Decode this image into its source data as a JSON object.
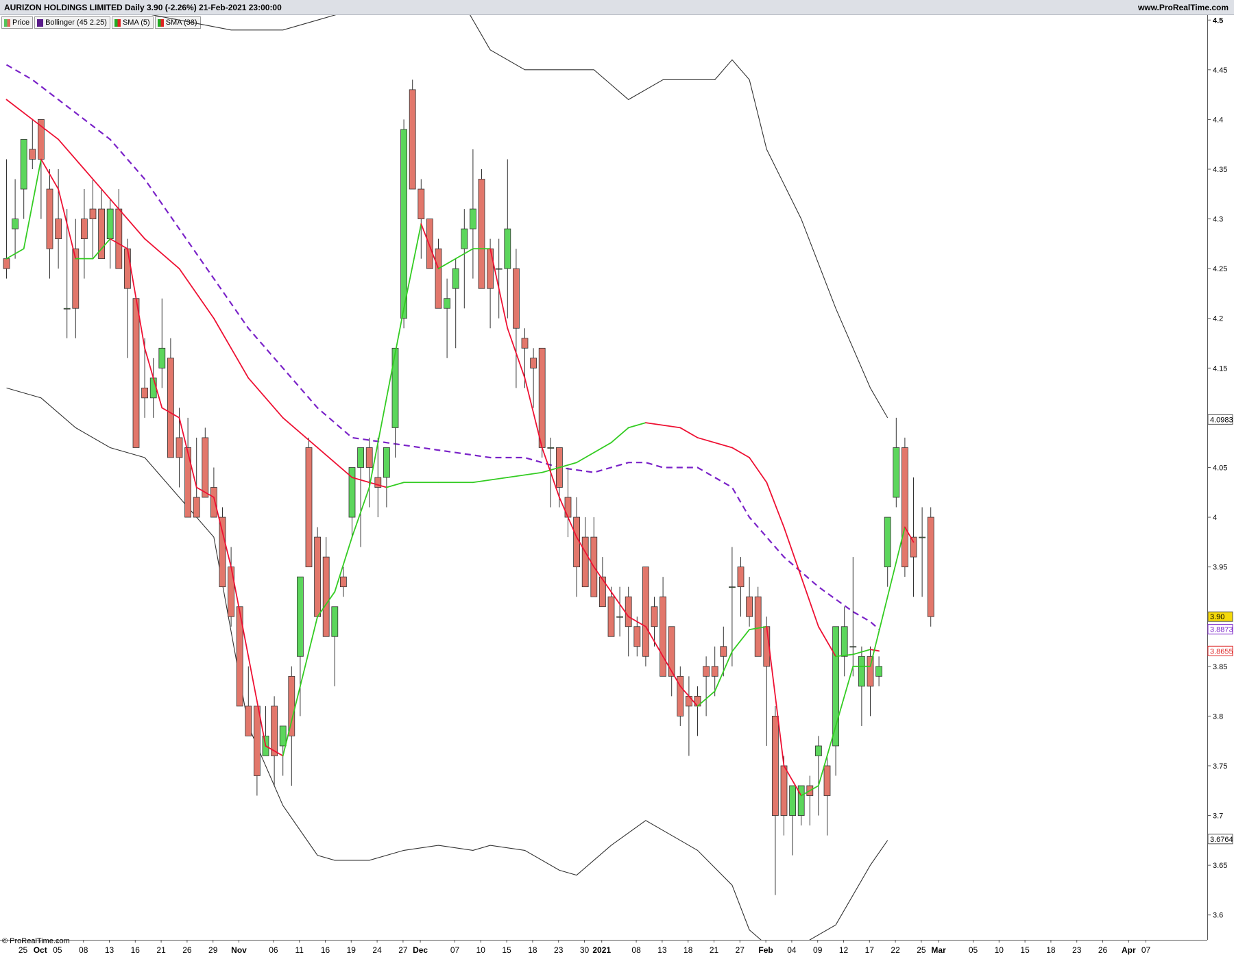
{
  "header": {
    "title": "AURIZON HOLDINGS LIMITED Daily 3.90 (-2.26%) 21-Feb-2021 23:00:00",
    "site": "www.ProRealTime.com"
  },
  "legend": [
    {
      "label": "Price",
      "colors": [
        "#55c45a",
        "#e06a5c"
      ]
    },
    {
      "label": "Bollinger (45 2.25)",
      "colors": [
        "#5a1c8a",
        "#5a1c8a"
      ]
    },
    {
      "label": "SMA (5)",
      "colors": [
        "#22aa22",
        "#dd2222"
      ]
    },
    {
      "label": "SMA (38)",
      "colors": [
        "#22aa22",
        "#dd2222"
      ]
    }
  ],
  "copyright": "© ProRealTime.com",
  "colors": {
    "up": "#5cd65c",
    "down": "#e2776b",
    "band": "#333333",
    "mid": "#7a22c8",
    "sma_up": "#33cc22",
    "sma_down": "#ee1133"
  },
  "chart_data": {
    "type": "candlestick",
    "ylim": [
      3.575,
      4.505
    ],
    "y_ticks": [
      "4.5",
      "4.45",
      "4.4",
      "4.35",
      "4.3",
      "4.25",
      "4.2",
      "4.15",
      "4.1",
      "4.05",
      "4",
      "3.95",
      "3.9",
      "3.85",
      "3.8",
      "3.75",
      "3.7",
      "3.65",
      "3.6"
    ],
    "x_ticks": [
      {
        "label": "25",
        "i": 0
      },
      {
        "label": "Oct",
        "i": 2,
        "bold": true
      },
      {
        "label": "05",
        "i": 4
      },
      {
        "label": "08",
        "i": 7
      },
      {
        "label": "13",
        "i": 10
      },
      {
        "label": "16",
        "i": 13
      },
      {
        "label": "21",
        "i": 16
      },
      {
        "label": "26",
        "i": 19
      },
      {
        "label": "29",
        "i": 22
      },
      {
        "label": "Nov",
        "i": 25,
        "bold": true
      },
      {
        "label": "06",
        "i": 29
      },
      {
        "label": "11",
        "i": 32
      },
      {
        "label": "16",
        "i": 35
      },
      {
        "label": "19",
        "i": 38
      },
      {
        "label": "24",
        "i": 41
      },
      {
        "label": "27",
        "i": 44
      },
      {
        "label": "Dec",
        "i": 46,
        "bold": true
      },
      {
        "label": "07",
        "i": 50
      },
      {
        "label": "10",
        "i": 53
      },
      {
        "label": "15",
        "i": 56
      },
      {
        "label": "18",
        "i": 59
      },
      {
        "label": "23",
        "i": 62
      },
      {
        "label": "30",
        "i": 65
      },
      {
        "label": "2021",
        "i": 67,
        "bold": true
      },
      {
        "label": "08",
        "i": 71
      },
      {
        "label": "13",
        "i": 74
      },
      {
        "label": "18",
        "i": 77
      },
      {
        "label": "21",
        "i": 80
      },
      {
        "label": "27",
        "i": 83
      },
      {
        "label": "Feb",
        "i": 86,
        "bold": true
      },
      {
        "label": "04",
        "i": 89
      },
      {
        "label": "09",
        "i": 92
      },
      {
        "label": "12",
        "i": 95
      },
      {
        "label": "17",
        "i": 98
      },
      {
        "label": "22",
        "i": 101
      },
      {
        "label": "25",
        "i": 104
      },
      {
        "label": "Mar",
        "i": 106,
        "bold": true
      },
      {
        "label": "05",
        "i": 110
      },
      {
        "label": "10",
        "i": 113
      },
      {
        "label": "15",
        "i": 116
      },
      {
        "label": "18",
        "i": 119
      },
      {
        "label": "23",
        "i": 122
      },
      {
        "label": "26",
        "i": 125
      },
      {
        "label": "Apr",
        "i": 128,
        "bold": true
      },
      {
        "label": "07",
        "i": 130
      }
    ],
    "candles": [
      [
        4.26,
        4.36,
        4.24,
        4.25
      ],
      [
        4.29,
        4.34,
        4.26,
        4.3
      ],
      [
        4.33,
        4.38,
        4.3,
        4.38
      ],
      [
        4.37,
        4.4,
        4.35,
        4.36
      ],
      [
        4.4,
        4.4,
        4.3,
        4.36
      ],
      [
        4.33,
        4.35,
        4.24,
        4.27
      ],
      [
        4.3,
        4.35,
        4.25,
        4.28
      ],
      [
        4.21,
        4.31,
        4.18,
        4.21
      ],
      [
        4.27,
        4.3,
        4.18,
        4.21
      ],
      [
        4.3,
        4.33,
        4.24,
        4.28
      ],
      [
        4.31,
        4.34,
        4.26,
        4.3
      ],
      [
        4.31,
        4.33,
        4.26,
        4.26
      ],
      [
        4.28,
        4.32,
        4.25,
        4.31
      ],
      [
        4.31,
        4.33,
        4.26,
        4.25
      ],
      [
        4.27,
        4.28,
        4.16,
        4.23
      ],
      [
        4.22,
        4.22,
        4.15,
        4.07
      ],
      [
        4.13,
        4.18,
        4.1,
        4.12
      ],
      [
        4.12,
        4.16,
        4.1,
        4.14
      ],
      [
        4.15,
        4.22,
        4.13,
        4.17
      ],
      [
        4.16,
        4.18,
        4.06,
        4.06
      ],
      [
        4.08,
        4.11,
        4.03,
        4.06
      ],
      [
        4.07,
        4.1,
        4.04,
        4.0
      ],
      [
        4.02,
        4.08,
        4.0,
        4.0
      ],
      [
        4.08,
        4.09,
        4.03,
        4.02
      ],
      [
        4.03,
        4.05,
        4.0,
        4.0
      ],
      [
        4.0,
        4.01,
        3.98,
        3.93
      ],
      [
        3.95,
        3.97,
        3.89,
        3.9
      ],
      [
        3.91,
        3.91,
        3.85,
        3.81
      ],
      [
        3.81,
        3.85,
        3.8,
        3.78
      ],
      [
        3.81,
        3.81,
        3.72,
        3.74
      ],
      [
        3.76,
        3.81,
        3.76,
        3.78
      ],
      [
        3.81,
        3.82,
        3.73,
        3.76
      ],
      [
        3.77,
        3.79,
        3.74,
        3.79
      ],
      [
        3.84,
        3.85,
        3.73,
        3.78
      ],
      [
        3.86,
        3.94,
        3.8,
        3.94
      ],
      [
        4.07,
        4.08,
        3.95,
        3.95
      ],
      [
        3.98,
        3.99,
        3.91,
        3.9
      ],
      [
        3.96,
        3.98,
        3.88,
        3.88
      ],
      [
        3.88,
        3.9,
        3.83,
        3.91
      ],
      [
        3.94,
        3.95,
        3.92,
        3.93
      ],
      [
        4.0,
        4.01,
        3.98,
        4.05
      ],
      [
        4.05,
        4.07,
        3.97,
        4.07
      ],
      [
        4.07,
        4.08,
        4.01,
        4.05
      ],
      [
        4.04,
        4.08,
        4.0,
        4.03
      ],
      [
        4.04,
        4.07,
        4.01,
        4.07
      ],
      [
        4.09,
        4.11,
        4.06,
        4.17
      ],
      [
        4.2,
        4.4,
        4.19,
        4.39
      ],
      [
        4.43,
        4.44,
        4.33,
        4.33
      ],
      [
        4.33,
        4.34,
        4.26,
        4.3
      ],
      [
        4.3,
        4.3,
        4.25,
        4.25
      ],
      [
        4.27,
        4.28,
        4.21,
        4.21
      ],
      [
        4.21,
        4.24,
        4.16,
        4.22
      ],
      [
        4.23,
        4.26,
        4.17,
        4.25
      ],
      [
        4.27,
        4.31,
        4.21,
        4.29
      ],
      [
        4.29,
        4.37,
        4.24,
        4.31
      ],
      [
        4.34,
        4.35,
        4.23,
        4.23
      ],
      [
        4.27,
        4.28,
        4.19,
        4.23
      ],
      [
        4.25,
        4.28,
        4.2,
        4.25
      ],
      [
        4.25,
        4.36,
        4.2,
        4.29
      ],
      [
        4.25,
        4.27,
        4.13,
        4.19
      ],
      [
        4.18,
        4.19,
        4.13,
        4.17
      ],
      [
        4.16,
        4.17,
        4.11,
        4.15
      ],
      [
        4.17,
        4.17,
        4.06,
        4.07
      ],
      [
        4.07,
        4.08,
        4.01,
        4.07
      ],
      [
        4.07,
        4.07,
        4.01,
        4.03
      ],
      [
        4.02,
        4.05,
        3.98,
        4.0
      ],
      [
        4.0,
        4.02,
        3.92,
        3.95
      ],
      [
        3.98,
        4.0,
        3.93,
        3.93
      ],
      [
        3.98,
        4.0,
        3.92,
        3.92
      ],
      [
        3.94,
        3.96,
        3.91,
        3.91
      ],
      [
        3.92,
        3.93,
        3.88,
        3.88
      ],
      [
        3.9,
        3.93,
        3.88,
        3.9
      ],
      [
        3.92,
        3.93,
        3.86,
        3.89
      ],
      [
        3.89,
        3.9,
        3.86,
        3.87
      ],
      [
        3.95,
        3.95,
        3.85,
        3.86
      ],
      [
        3.91,
        3.92,
        3.87,
        3.89
      ],
      [
        3.92,
        3.94,
        3.86,
        3.84
      ],
      [
        3.89,
        3.89,
        3.82,
        3.84
      ],
      [
        3.84,
        3.85,
        3.79,
        3.8
      ],
      [
        3.82,
        3.84,
        3.76,
        3.81
      ],
      [
        3.82,
        3.83,
        3.78,
        3.81
      ],
      [
        3.85,
        3.86,
        3.8,
        3.84
      ],
      [
        3.85,
        3.87,
        3.82,
        3.84
      ],
      [
        3.87,
        3.89,
        3.84,
        3.86
      ],
      [
        3.93,
        3.97,
        3.85,
        3.93
      ],
      [
        3.95,
        3.96,
        3.9,
        3.93
      ],
      [
        3.92,
        3.94,
        3.89,
        3.9
      ],
      [
        3.92,
        3.93,
        3.86,
        3.86
      ],
      [
        3.89,
        3.9,
        3.77,
        3.85
      ],
      [
        3.8,
        3.81,
        3.62,
        3.7
      ],
      [
        3.75,
        3.76,
        3.68,
        3.7
      ],
      [
        3.7,
        3.72,
        3.66,
        3.73
      ],
      [
        3.7,
        3.73,
        3.69,
        3.73
      ],
      [
        3.73,
        3.74,
        3.69,
        3.72
      ],
      [
        3.76,
        3.78,
        3.7,
        3.77
      ],
      [
        3.75,
        3.76,
        3.68,
        3.72
      ],
      [
        3.77,
        3.8,
        3.74,
        3.89
      ],
      [
        3.86,
        3.91,
        3.84,
        3.89
      ],
      [
        3.87,
        3.96,
        3.84,
        3.87
      ],
      [
        3.83,
        3.87,
        3.79,
        3.86
      ],
      [
        3.86,
        3.87,
        3.8,
        3.83
      ],
      [
        3.84,
        3.86,
        3.83,
        3.85
      ],
      [
        3.95,
        3.97,
        3.93,
        4.0
      ],
      [
        4.02,
        4.1,
        4.01,
        4.07
      ],
      [
        4.07,
        4.08,
        3.94,
        3.95
      ],
      [
        3.98,
        4.04,
        3.92,
        3.96
      ],
      [
        3.98,
        4.01,
        3.92,
        3.98
      ],
      [
        4.0,
        4.01,
        3.89,
        3.9
      ]
    ],
    "candles_note": "[open, high, low, close] daily values, one per trading day",
    "bollinger_upper": [
      [
        0,
        4.52
      ],
      [
        6,
        4.52
      ],
      [
        10,
        4.51
      ],
      [
        14,
        4.51
      ],
      [
        20,
        4.5
      ],
      [
        26,
        4.49
      ],
      [
        32,
        4.49
      ],
      [
        36,
        4.5
      ],
      [
        40,
        4.51
      ],
      [
        42,
        4.51
      ],
      [
        45,
        4.53
      ],
      [
        48,
        4.55
      ],
      [
        52,
        4.53
      ],
      [
        56,
        4.47
      ],
      [
        60,
        4.45
      ],
      [
        64,
        4.45
      ],
      [
        68,
        4.45
      ],
      [
        72,
        4.42
      ],
      [
        76,
        4.44
      ],
      [
        80,
        4.44
      ],
      [
        82,
        4.44
      ],
      [
        84,
        4.46
      ],
      [
        86,
        4.44
      ],
      [
        88,
        4.37
      ],
      [
        92,
        4.3
      ],
      [
        96,
        4.21
      ],
      [
        100,
        4.13
      ],
      [
        102,
        4.1
      ]
    ],
    "bollinger_mid": [
      [
        0,
        4.455
      ],
      [
        3,
        4.44
      ],
      [
        6,
        4.42
      ],
      [
        9,
        4.4
      ],
      [
        12,
        4.38
      ],
      [
        16,
        4.34
      ],
      [
        20,
        4.29
      ],
      [
        24,
        4.24
      ],
      [
        28,
        4.19
      ],
      [
        32,
        4.15
      ],
      [
        36,
        4.11
      ],
      [
        38,
        4.095
      ],
      [
        40,
        4.08
      ],
      [
        44,
        4.075
      ],
      [
        48,
        4.07
      ],
      [
        52,
        4.065
      ],
      [
        56,
        4.06
      ],
      [
        60,
        4.06
      ],
      [
        64,
        4.05
      ],
      [
        68,
        4.045
      ],
      [
        72,
        4.055
      ],
      [
        74,
        4.055
      ],
      [
        76,
        4.05
      ],
      [
        80,
        4.05
      ],
      [
        84,
        4.03
      ],
      [
        86,
        4.0
      ],
      [
        90,
        3.96
      ],
      [
        94,
        3.93
      ],
      [
        98,
        3.905
      ],
      [
        100,
        3.895
      ],
      [
        101,
        3.8873
      ]
    ],
    "bollinger_lower": [
      [
        0,
        4.13
      ],
      [
        4,
        4.12
      ],
      [
        8,
        4.09
      ],
      [
        12,
        4.07
      ],
      [
        16,
        4.06
      ],
      [
        20,
        4.02
      ],
      [
        24,
        3.98
      ],
      [
        28,
        3.79
      ],
      [
        32,
        3.71
      ],
      [
        36,
        3.66
      ],
      [
        38,
        3.655
      ],
      [
        42,
        3.655
      ],
      [
        46,
        3.665
      ],
      [
        50,
        3.67
      ],
      [
        54,
        3.665
      ],
      [
        56,
        3.67
      ],
      [
        60,
        3.665
      ],
      [
        64,
        3.645
      ],
      [
        66,
        3.64
      ],
      [
        70,
        3.67
      ],
      [
        74,
        3.695
      ],
      [
        78,
        3.675
      ],
      [
        80,
        3.665
      ],
      [
        84,
        3.63
      ],
      [
        86,
        3.585
      ],
      [
        88,
        3.57
      ],
      [
        92,
        3.57
      ],
      [
        96,
        3.59
      ],
      [
        100,
        3.65
      ],
      [
        102,
        3.675
      ]
    ],
    "sma5": [
      [
        0,
        4.26
      ],
      [
        2,
        4.27
      ],
      [
        4,
        4.36
      ],
      [
        6,
        4.33
      ],
      [
        8,
        4.26
      ],
      [
        10,
        4.26
      ],
      [
        12,
        4.28
      ],
      [
        14,
        4.27
      ],
      [
        16,
        4.17
      ],
      [
        18,
        4.11
      ],
      [
        20,
        4.1
      ],
      [
        22,
        4.03
      ],
      [
        24,
        4.02
      ],
      [
        26,
        3.95
      ],
      [
        28,
        3.86
      ],
      [
        30,
        3.77
      ],
      [
        32,
        3.76
      ],
      [
        34,
        3.83
      ],
      [
        36,
        3.9
      ],
      [
        38,
        3.925
      ],
      [
        40,
        3.98
      ],
      [
        42,
        4.03
      ],
      [
        44,
        4.12
      ],
      [
        46,
        4.21
      ],
      [
        48,
        4.295
      ],
      [
        50,
        4.25
      ],
      [
        52,
        4.26
      ],
      [
        54,
        4.27
      ],
      [
        56,
        4.27
      ],
      [
        58,
        4.19
      ],
      [
        60,
        4.14
      ],
      [
        62,
        4.07
      ],
      [
        64,
        4.02
      ],
      [
        66,
        3.98
      ],
      [
        68,
        3.95
      ],
      [
        70,
        3.925
      ],
      [
        72,
        3.9
      ],
      [
        74,
        3.89
      ],
      [
        76,
        3.86
      ],
      [
        78,
        3.83
      ],
      [
        80,
        3.81
      ],
      [
        82,
        3.825
      ],
      [
        84,
        3.865
      ],
      [
        86,
        3.887
      ],
      [
        88,
        3.89
      ],
      [
        90,
        3.75
      ],
      [
        92,
        3.72
      ],
      [
        94,
        3.73
      ],
      [
        96,
        3.79
      ],
      [
        98,
        3.85
      ],
      [
        100,
        3.85
      ],
      [
        102,
        3.92
      ],
      [
        104,
        3.99
      ],
      [
        105,
        3.975
      ]
    ],
    "sma38": [
      [
        0,
        4.42
      ],
      [
        3,
        4.4
      ],
      [
        6,
        4.38
      ],
      [
        9,
        4.35
      ],
      [
        12,
        4.32
      ],
      [
        16,
        4.28
      ],
      [
        20,
        4.25
      ],
      [
        24,
        4.2
      ],
      [
        28,
        4.14
      ],
      [
        32,
        4.1
      ],
      [
        36,
        4.07
      ],
      [
        40,
        4.04
      ],
      [
        42,
        4.035
      ],
      [
        44,
        4.03
      ],
      [
        46,
        4.035
      ],
      [
        50,
        4.035
      ],
      [
        54,
        4.035
      ],
      [
        58,
        4.04
      ],
      [
        62,
        4.045
      ],
      [
        66,
        4.055
      ],
      [
        70,
        4.075
      ],
      [
        72,
        4.09
      ],
      [
        74,
        4.095
      ],
      [
        78,
        4.09
      ],
      [
        80,
        4.08
      ],
      [
        84,
        4.07
      ],
      [
        86,
        4.06
      ],
      [
        88,
        4.035
      ],
      [
        90,
        3.99
      ],
      [
        92,
        3.94
      ],
      [
        94,
        3.89
      ],
      [
        96,
        3.86
      ],
      [
        98,
        3.862
      ],
      [
        100,
        3.867
      ],
      [
        101,
        3.8655
      ]
    ],
    "price_labels": [
      {
        "value": 4.0983,
        "text": "4.0983",
        "kind": "band"
      },
      {
        "value": 3.9,
        "text": "3.90",
        "kind": "price"
      },
      {
        "value": 3.8873,
        "text": "3.8873",
        "kind": "mid"
      },
      {
        "value": 3.8655,
        "text": "3.8655",
        "kind": "sma"
      },
      {
        "value": 3.6764,
        "text": "3.6764",
        "kind": "band"
      }
    ]
  }
}
